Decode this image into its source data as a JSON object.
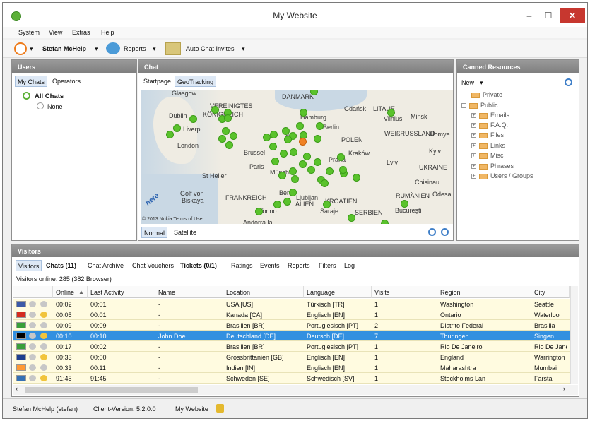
{
  "window": {
    "title": "My Website",
    "minimize": "–",
    "maximize": "☐",
    "close": "✕"
  },
  "menu": [
    "System",
    "View",
    "Extras",
    "Help"
  ],
  "toolbar": {
    "user": "Stefan McHelp",
    "reports": "Reports",
    "auto_chat": "Auto Chat Invites"
  },
  "users": {
    "title": "Users",
    "tabs": [
      "My Chats",
      "Operators"
    ],
    "tree_root": "All Chats",
    "tree_child": "None"
  },
  "chat": {
    "title": "Chat",
    "tabs": [
      "Startpage",
      "GeoTracking"
    ],
    "modes": [
      "Normal",
      "Satellite"
    ],
    "copyright": "© 2013 Nokia Terms of Use",
    "brand": "here"
  },
  "map": {
    "labels": [
      "Glasgow",
      "VEREINIGTES",
      "KÖNIGREICH",
      "Dublin",
      "Liverp",
      "London",
      "Brussel",
      "Paris",
      "St Helier",
      "Golf von",
      "Biskaya",
      "FRANKREICH",
      "Torino",
      "Andorra la",
      "DANMARK",
      "Hamburg",
      "Berlin",
      "Gdańsk",
      "Vilnius",
      "Minsk",
      "LITAUE",
      "WEIßRUSSLAND",
      "Homye",
      "POLEN",
      "Kraków",
      "Kyiv",
      "Lviv",
      "UKRAINE",
      "Chisinau",
      "Odesa",
      "RUMÄNIEN",
      "Bucureşti",
      "SERBIEN",
      "Saraje",
      "KROATIEN",
      "Ljubljan",
      "ALIEN",
      "Bern",
      "München",
      "Praha",
      "dam"
    ]
  },
  "canned": {
    "title": "Canned Resources",
    "new": "New",
    "items": [
      "Private",
      "Public",
      "Emails",
      "F.A.Q.",
      "Files",
      "Links",
      "Misc",
      "Phrases",
      "Users / Groups"
    ]
  },
  "visitors": {
    "title": "Visitors",
    "tabs": [
      "Visitors",
      "Chats (11)",
      "Chat Archive",
      "Chat Vouchers",
      "Tickets (0/1)",
      "Ratings",
      "Events",
      "Reports",
      "Filters",
      "Log"
    ],
    "online_text": "Visitors online: 285 (382 Browser)",
    "columns": [
      "Online",
      "Last Activity",
      "Name",
      "Location",
      "Language",
      "Visits",
      "Region",
      "City"
    ],
    "rows": [
      [
        "00:02",
        "00:01",
        "-",
        "USA [US]",
        "Türkisch [TR]",
        "1",
        "Washington",
        "Seattle"
      ],
      [
        "00:05",
        "00:01",
        "-",
        "Kanada [CA]",
        "Englisch [EN]",
        "1",
        "Ontario",
        "Waterloo"
      ],
      [
        "00:09",
        "00:09",
        "-",
        "Brasilien [BR]",
        "Portugiesisch [PT]",
        "2",
        "Distrito Federal",
        "Brasilia"
      ],
      [
        "00:10",
        "00:10",
        "John Doe",
        "Deutschland [DE]",
        "Deutsch [DE]",
        "7",
        "Thuringen",
        "Singen"
      ],
      [
        "00:17",
        "00:02",
        "-",
        "Brasilien [BR]",
        "Portugiesisch [PT]",
        "1",
        "Rio De Janeiro",
        "Rio De Janeir"
      ],
      [
        "00:33",
        "00:00",
        "-",
        "Grossbrittanien [GB]",
        "Englisch [EN]",
        "1",
        "England",
        "Warrington"
      ],
      [
        "00:33",
        "00:11",
        "-",
        "Indien [IN]",
        "Englisch [EN]",
        "1",
        "Maharashtra",
        "Mumbai"
      ],
      [
        "91:45",
        "91:45",
        "-",
        "Schweden [SE]",
        "Schwedisch [SV]",
        "1",
        "Stockholms Lan",
        "Farsta"
      ]
    ],
    "flag_colors": [
      "#3c5aa8",
      "#d52b1e",
      "#3a9f3a",
      "#000000",
      "#3a9f3a",
      "#1f3f8f",
      "#ff9933",
      "#3370b5"
    ]
  },
  "status": {
    "user": "Stefan McHelp (stefan)",
    "version": "Client-Version: 5.2.0.0",
    "site": "My Website"
  }
}
